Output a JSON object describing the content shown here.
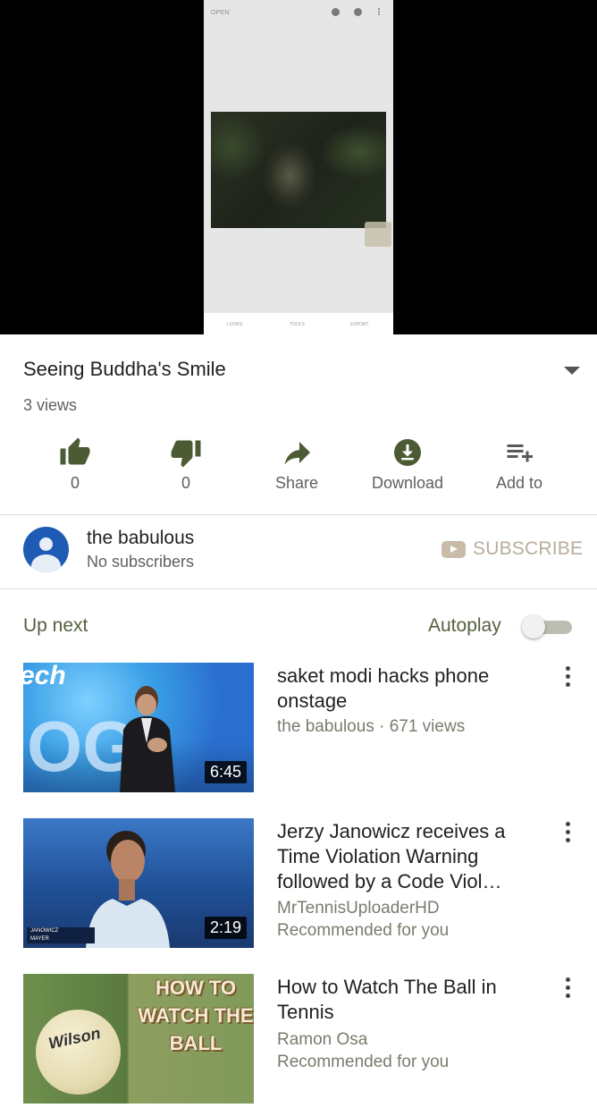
{
  "player": {
    "phone_open_label": "OPEN",
    "phone_tabs": [
      "LOOKS",
      "TOOLS",
      "EXPORT"
    ]
  },
  "video": {
    "title": "Seeing Buddha's Smile",
    "views": "3 views"
  },
  "actions": [
    {
      "label": "0",
      "icon": "thumbs-up-icon"
    },
    {
      "label": "0",
      "icon": "thumbs-down-icon"
    },
    {
      "label": "Share",
      "icon": "share-icon"
    },
    {
      "label": "Download",
      "icon": "download-icon"
    },
    {
      "label": "Add to",
      "icon": "playlist-add-icon"
    }
  ],
  "channel": {
    "name": "the babulous",
    "subscribers": "No subscribers",
    "subscribe_label": "SUBSCRIBE"
  },
  "up_next": {
    "heading": "Up next",
    "autoplay_label": "Autoplay",
    "autoplay_on": false
  },
  "recommendations": [
    {
      "title": "saket modi hacks phone onstage",
      "meta_line1": "the babulous · 671 views",
      "meta_line2": "",
      "duration": "6:45",
      "thumb_text": "ech",
      "thumb_big": "OGI"
    },
    {
      "title": "Jerzy Janowicz receives a Time Violation Warning followed by a Code Viol…",
      "meta_line1": "MrTennisUploaderHD",
      "meta_line2": "Recommended for you",
      "duration": "2:19",
      "score_rows": [
        "JANOWICZ",
        "MAYER"
      ]
    },
    {
      "title": "How to Watch The Ball in Tennis",
      "meta_line1": "Ramon Osa",
      "meta_line2": "Recommended for you",
      "duration": "",
      "thumb_text_lines": [
        "HOW TO",
        "WATCH THE",
        "BALL"
      ],
      "ball_brand": "Wilson"
    }
  ],
  "colors": {
    "accent_olive": "#55603f",
    "subscribe_muted": "#b7ad9c",
    "icon_green": "#4d5b35"
  }
}
